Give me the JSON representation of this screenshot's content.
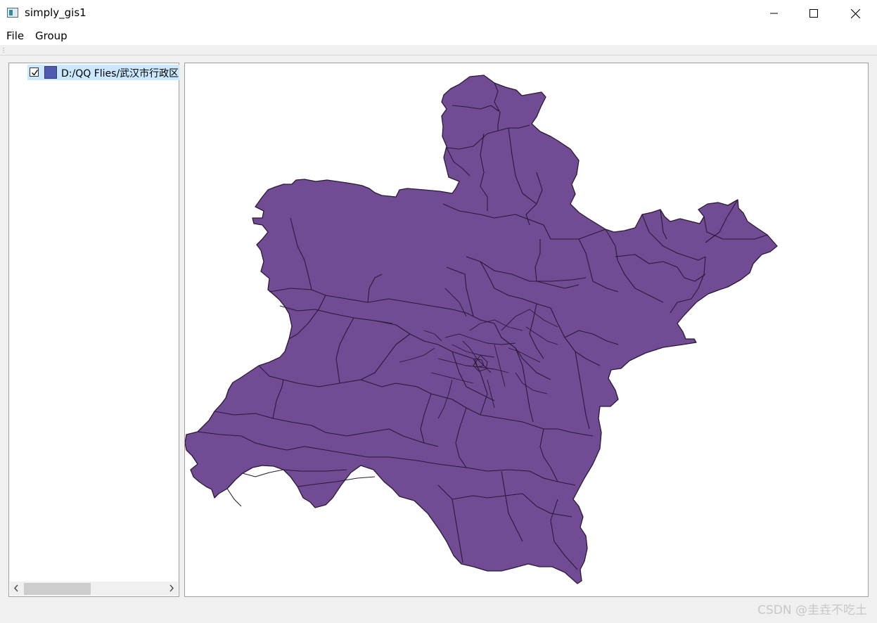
{
  "window": {
    "title": "simply_gis1",
    "app_icon": "app-window-icon",
    "controls": [
      "minimize-icon",
      "maximize-icon",
      "close-icon"
    ]
  },
  "menu": {
    "file": "File",
    "group": "Group"
  },
  "layers": {
    "items": [
      {
        "checked": true,
        "name": "D:/QQ Flies/武汉市行政区",
        "swatch_color": "#4f5bb0"
      }
    ]
  },
  "map": {
    "fill_color": "#714b93",
    "outline_color": "#2a1a35"
  },
  "watermark": "CSDN @圭垚不吃土"
}
